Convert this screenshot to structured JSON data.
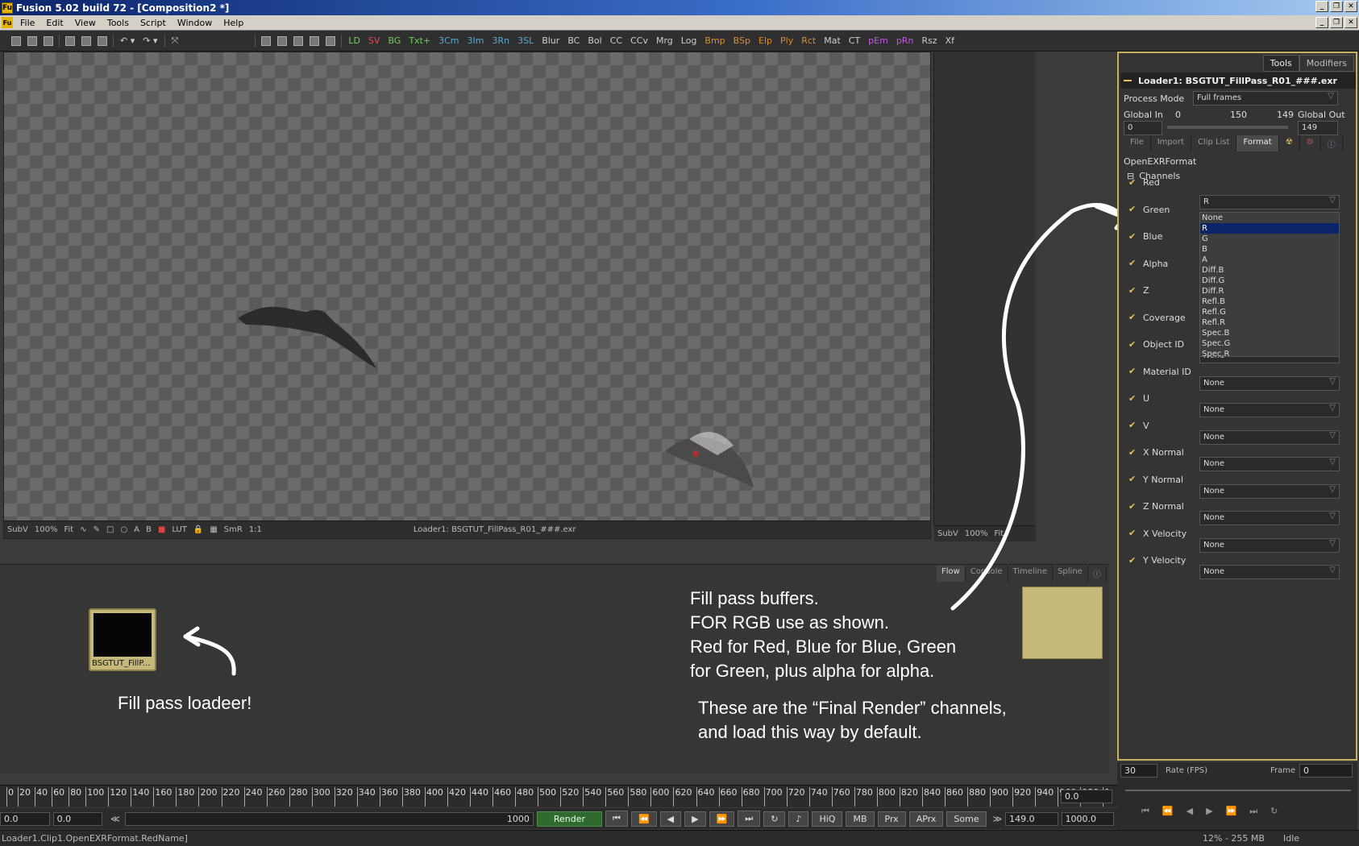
{
  "window": {
    "title": "Fusion 5.02 build 72 - [Composition2 *]"
  },
  "menu": [
    "File",
    "Edit",
    "View",
    "Tools",
    "Script",
    "Window",
    "Help"
  ],
  "toolbar": {
    "items": [
      {
        "label": "LD",
        "color": "green"
      },
      {
        "label": "SV",
        "color": "red"
      },
      {
        "label": "BG",
        "color": "green"
      },
      {
        "label": "Txt+",
        "color": "green"
      },
      {
        "label": "3Cm",
        "color": "cyan"
      },
      {
        "label": "3Im",
        "color": "cyan"
      },
      {
        "label": "3Rn",
        "color": "cyan"
      },
      {
        "label": "3SL",
        "color": "cyan"
      },
      {
        "label": "Blur",
        "color": "white"
      },
      {
        "label": "BC",
        "color": "white"
      },
      {
        "label": "Bol",
        "color": "white"
      },
      {
        "label": "CC",
        "color": "white"
      },
      {
        "label": "CCv",
        "color": "white"
      },
      {
        "label": "Mrg",
        "color": "white"
      },
      {
        "label": "Log",
        "color": "white"
      },
      {
        "label": "Bmp",
        "color": "orange"
      },
      {
        "label": "BSp",
        "color": "orange"
      },
      {
        "label": "Elp",
        "color": "orange"
      },
      {
        "label": "Ply",
        "color": "orange"
      },
      {
        "label": "Rct",
        "color": "orange"
      },
      {
        "label": "Mat",
        "color": "white"
      },
      {
        "label": "CT",
        "color": "white"
      },
      {
        "label": "pEm",
        "color": "purple"
      },
      {
        "label": "pRn",
        "color": "purple"
      },
      {
        "label": "Rsz",
        "color": "white"
      },
      {
        "label": "Xf",
        "color": "white"
      }
    ]
  },
  "viewer": {
    "subv": "SubV",
    "zoom": "100%",
    "fit": "Fit",
    "ab_a": "A",
    "ab_b": "B",
    "lut": "LUT",
    "smr": "SmR",
    "one": "1:1",
    "caption": "Loader1: BSGTUT_FillPass_R01_###.exr"
  },
  "viewer2": {
    "subv": "SubV",
    "zoom": "100%",
    "fit": "Fit"
  },
  "lower_tabs": [
    "Flow",
    "Console",
    "Timeline",
    "Spline"
  ],
  "node": {
    "label": "BSGTUT_FillP..."
  },
  "annotations": {
    "loader_note": "Fill pass loadeer!",
    "buffers_note": "Fill pass buffers.\nFOR RGB use as shown.\nRed for Red, Blue for Blue, Green\nfor Green, plus alpha for alpha.",
    "final_note": "These are the “Final Render” channels,\nand load this way by default."
  },
  "timeline": {
    "ticks": [
      "0",
      "20",
      "40",
      "60",
      "80",
      "100",
      "120",
      "140",
      "160",
      "180",
      "200",
      "220",
      "240",
      "260",
      "280",
      "300",
      "320",
      "340",
      "360",
      "380",
      "400",
      "420",
      "440",
      "460",
      "480",
      "500",
      "520",
      "540",
      "560",
      "580",
      "600",
      "620",
      "640",
      "660",
      "680",
      "700",
      "720",
      "740",
      "760",
      "780",
      "800",
      "820",
      "840",
      "860",
      "880",
      "900",
      "920",
      "940",
      "960",
      "980",
      "1"
    ],
    "end_field": "0.0"
  },
  "transport": {
    "start": "0.0",
    "current": "0.0",
    "range_end": "1000",
    "render": "Render",
    "buttons": [
      "HiQ",
      "MB",
      "Prx",
      "APrx",
      "Some"
    ],
    "cur_frame": "149.0",
    "end_frame": "1000.0"
  },
  "status": {
    "text": "Loader1.Clip1.OpenEXRFormat.RedName]",
    "mem": "12% - 255 MB",
    "state": "Idle"
  },
  "inspector": {
    "tabs": [
      "Tools",
      "Modifiers"
    ],
    "tool_name": "Loader1: BSGTUT_FillPass_R01_###.exr",
    "process_mode_label": "Process Mode",
    "process_mode": "Full frames",
    "global_in_label": "Global In",
    "global_in": "0",
    "slider_min": "0",
    "slider_mid": "150",
    "slider_max": "149",
    "global_out_label": "Global Out",
    "global_out": "149",
    "subtabs": [
      "File",
      "Import",
      "Clip List",
      "Format"
    ],
    "format_label": "OpenEXRFormat",
    "channels_label": "Channels",
    "channels": [
      {
        "name": "Red",
        "value": "R"
      },
      {
        "name": "Green",
        "value": ""
      },
      {
        "name": "Blue",
        "value": ""
      },
      {
        "name": "Alpha",
        "value": ""
      },
      {
        "name": "Z",
        "value": ""
      },
      {
        "name": "Coverage",
        "value": ""
      },
      {
        "name": "Object ID",
        "value": "None"
      },
      {
        "name": "Material ID",
        "value": "None"
      },
      {
        "name": "U",
        "value": "None"
      },
      {
        "name": "V",
        "value": "None"
      },
      {
        "name": "X Normal",
        "value": "None"
      },
      {
        "name": "Y Normal",
        "value": "None"
      },
      {
        "name": "Z Normal",
        "value": "None"
      },
      {
        "name": "X Velocity",
        "value": "None"
      },
      {
        "name": "Y Velocity",
        "value": "None"
      }
    ],
    "dropdown_options": [
      "None",
      "R",
      "G",
      "B",
      "A",
      "Diff.B",
      "Diff.G",
      "Diff.R",
      "Refl.B",
      "Refl.G",
      "Refl.R",
      "Spec.B",
      "Spec.G",
      "Spec.R"
    ],
    "dropdown_selected": "R",
    "rate_value": "30",
    "rate_label": "Rate (FPS)",
    "frame_label": "Frame",
    "frame_value": "0"
  }
}
